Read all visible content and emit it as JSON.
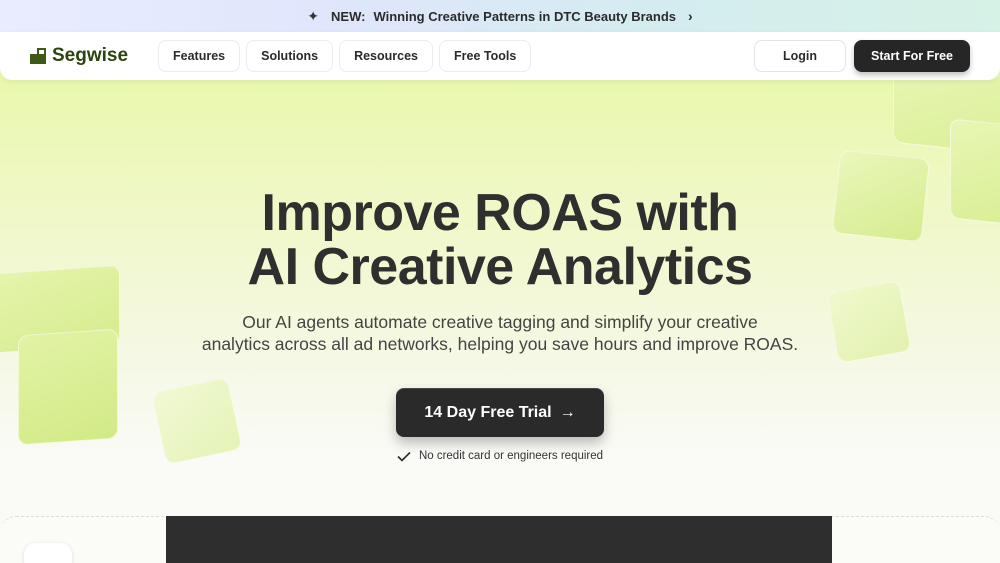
{
  "announcement": {
    "prefix": "NEW:",
    "text": "Winning Creative Patterns in DTC Beauty Brands",
    "icon": "sparkle-icon"
  },
  "nav": {
    "brand": "Segwise",
    "menu": [
      "Features",
      "Solutions",
      "Resources",
      "Free Tools"
    ],
    "login": "Login",
    "start": "Start For Free"
  },
  "hero": {
    "headline_line1": "Improve ROAS with",
    "headline_line2": "AI Creative Analytics",
    "sub_line1": "Our AI agents automate creative tagging and simplify your creative",
    "sub_line2": "analytics across all ad networks, helping you save hours and improve ROAS.",
    "cta": "14 Day Free Trial",
    "note": "No credit card or engineers required"
  },
  "colors": {
    "brand_green": "#2c4410",
    "hero_lime": "#e6f8a3",
    "dark_button": "#262626"
  }
}
